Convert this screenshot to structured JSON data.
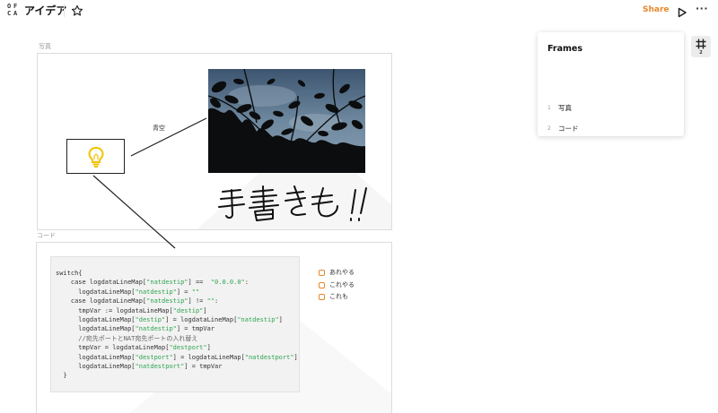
{
  "header": {
    "logo_letters": [
      "O",
      "F",
      "C",
      "A"
    ],
    "title": "アイデア",
    "share_label": "Share",
    "more_label": "···",
    "icons": [
      "logo-icon",
      "star-icon",
      "play-icon",
      "more-icon"
    ]
  },
  "frames": [
    {
      "label": "写真"
    },
    {
      "label": "コード"
    }
  ],
  "canvas": {
    "edge_label": "青空",
    "handwriting": "手書きも!!",
    "code_lines": [
      [
        {
          "t": "switch{"
        }
      ],
      [
        {
          "t": "    case logdataLineMap["
        },
        {
          "t": "\"natdestip\"",
          "c": "str"
        },
        {
          "t": "] ==  "
        },
        {
          "t": "\"0.0.0.0\"",
          "c": "str"
        },
        {
          "t": ":"
        }
      ],
      [
        {
          "t": "      logdataLineMap["
        },
        {
          "t": "\"natdestip\"",
          "c": "str"
        },
        {
          "t": "] = "
        },
        {
          "t": "\"\"",
          "c": "str"
        }
      ],
      [
        {
          "t": "    case logdataLineMap["
        },
        {
          "t": "\"natdestip\"",
          "c": "str"
        },
        {
          "t": "] != "
        },
        {
          "t": "\"\"",
          "c": "str"
        },
        {
          "t": ":"
        }
      ],
      [
        {
          "t": "      tmpVar := logdataLineMap["
        },
        {
          "t": "\"destip\"",
          "c": "str"
        },
        {
          "t": "]"
        }
      ],
      [
        {
          "t": "      logdataLineMap["
        },
        {
          "t": "\"destip\"",
          "c": "str"
        },
        {
          "t": "] = logdataLineMap["
        },
        {
          "t": "\"natdestip\"",
          "c": "str"
        },
        {
          "t": "]"
        }
      ],
      [
        {
          "t": "      logdataLineMap["
        },
        {
          "t": "\"natdestip\"",
          "c": "str"
        },
        {
          "t": "] = tmpVar"
        }
      ],
      [
        {
          "t": "      //宛先ポートとNAT宛先ポートの入れ替え",
          "c": "comment"
        }
      ],
      [
        {
          "t": "      tmpVar = logdataLineMap["
        },
        {
          "t": "\"destport\"",
          "c": "str"
        },
        {
          "t": "]"
        }
      ],
      [
        {
          "t": "      logdataLineMap["
        },
        {
          "t": "\"destport\"",
          "c": "str"
        },
        {
          "t": "] = logdataLineMap["
        },
        {
          "t": "\"natdestport\"",
          "c": "str"
        },
        {
          "t": "]"
        }
      ],
      [
        {
          "t": "      logdataLineMap["
        },
        {
          "t": "\"natdestport\"",
          "c": "str"
        },
        {
          "t": "] = tmpVar"
        }
      ],
      [
        {
          "t": "  }"
        }
      ]
    ],
    "checklist": [
      "あれやる",
      "これやる",
      "これも"
    ],
    "icons": [
      "lightbulb-icon",
      "photo-image"
    ]
  },
  "frames_panel": {
    "title": "Frames",
    "items": [
      {
        "num": "1",
        "name": "写真"
      },
      {
        "num": "2",
        "name": "コード"
      }
    ],
    "toggle_count": "2",
    "toggle_icon": "frame-icon"
  },
  "colors": {
    "accent": "#e8872a",
    "code_bg": "#f2f2f2",
    "code_string": "#2ea44f",
    "bulb": "#f2c200"
  }
}
